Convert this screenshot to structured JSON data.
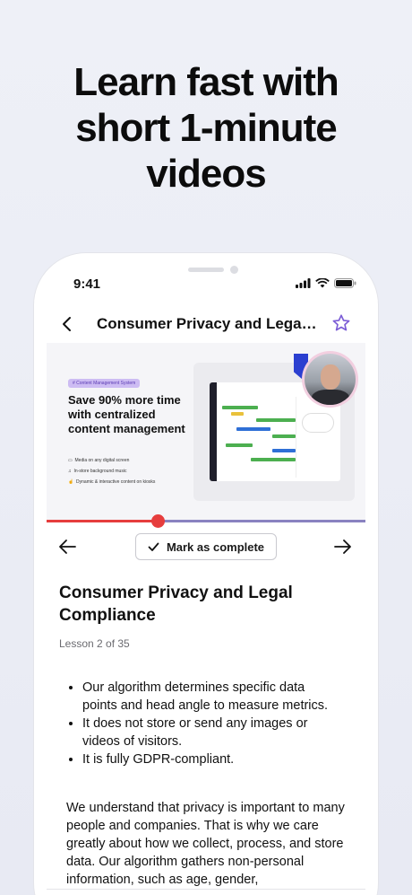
{
  "headline": {
    "lines": [
      "Learn fast with",
      "short 1-minute",
      "videos"
    ]
  },
  "status_bar": {
    "time": "9:41"
  },
  "nav": {
    "title": "Consumer Privacy and Legal Co..."
  },
  "video": {
    "pill": "# Content Management System",
    "heading": "Save 90% more time with centralized content management",
    "features": [
      "Media on any digital screen",
      "In-store background music",
      "Dynamic & interactive content on kiosks"
    ],
    "progress_fraction": 0.35
  },
  "lesson_nav": {
    "mark_complete_label": "Mark as complete"
  },
  "lesson": {
    "title": "Consumer Privacy and Legal Compliance",
    "subtitle": "Lesson 2 of 35",
    "bullets": [
      "Our algorithm determines specific data points and head angle to measure metrics.",
      "It does not store or send any images or videos of visitors.",
      "It is fully GDPR-compliant."
    ],
    "paragraph": "We understand that privacy is important to many people and companies. That is why we care greatly about how we collect, process, and store data. Our algorithm gathers non-personal information, such as age, gender,"
  },
  "colors": {
    "accent": "#7b5cd6",
    "progress": "#e63d3d",
    "track": "#8a82c0"
  },
  "icons": [
    "back-chevron-icon",
    "star-icon",
    "signal-icon",
    "wifi-icon",
    "battery-icon",
    "arrow-left-icon",
    "arrow-right-icon",
    "checkmark-icon"
  ]
}
